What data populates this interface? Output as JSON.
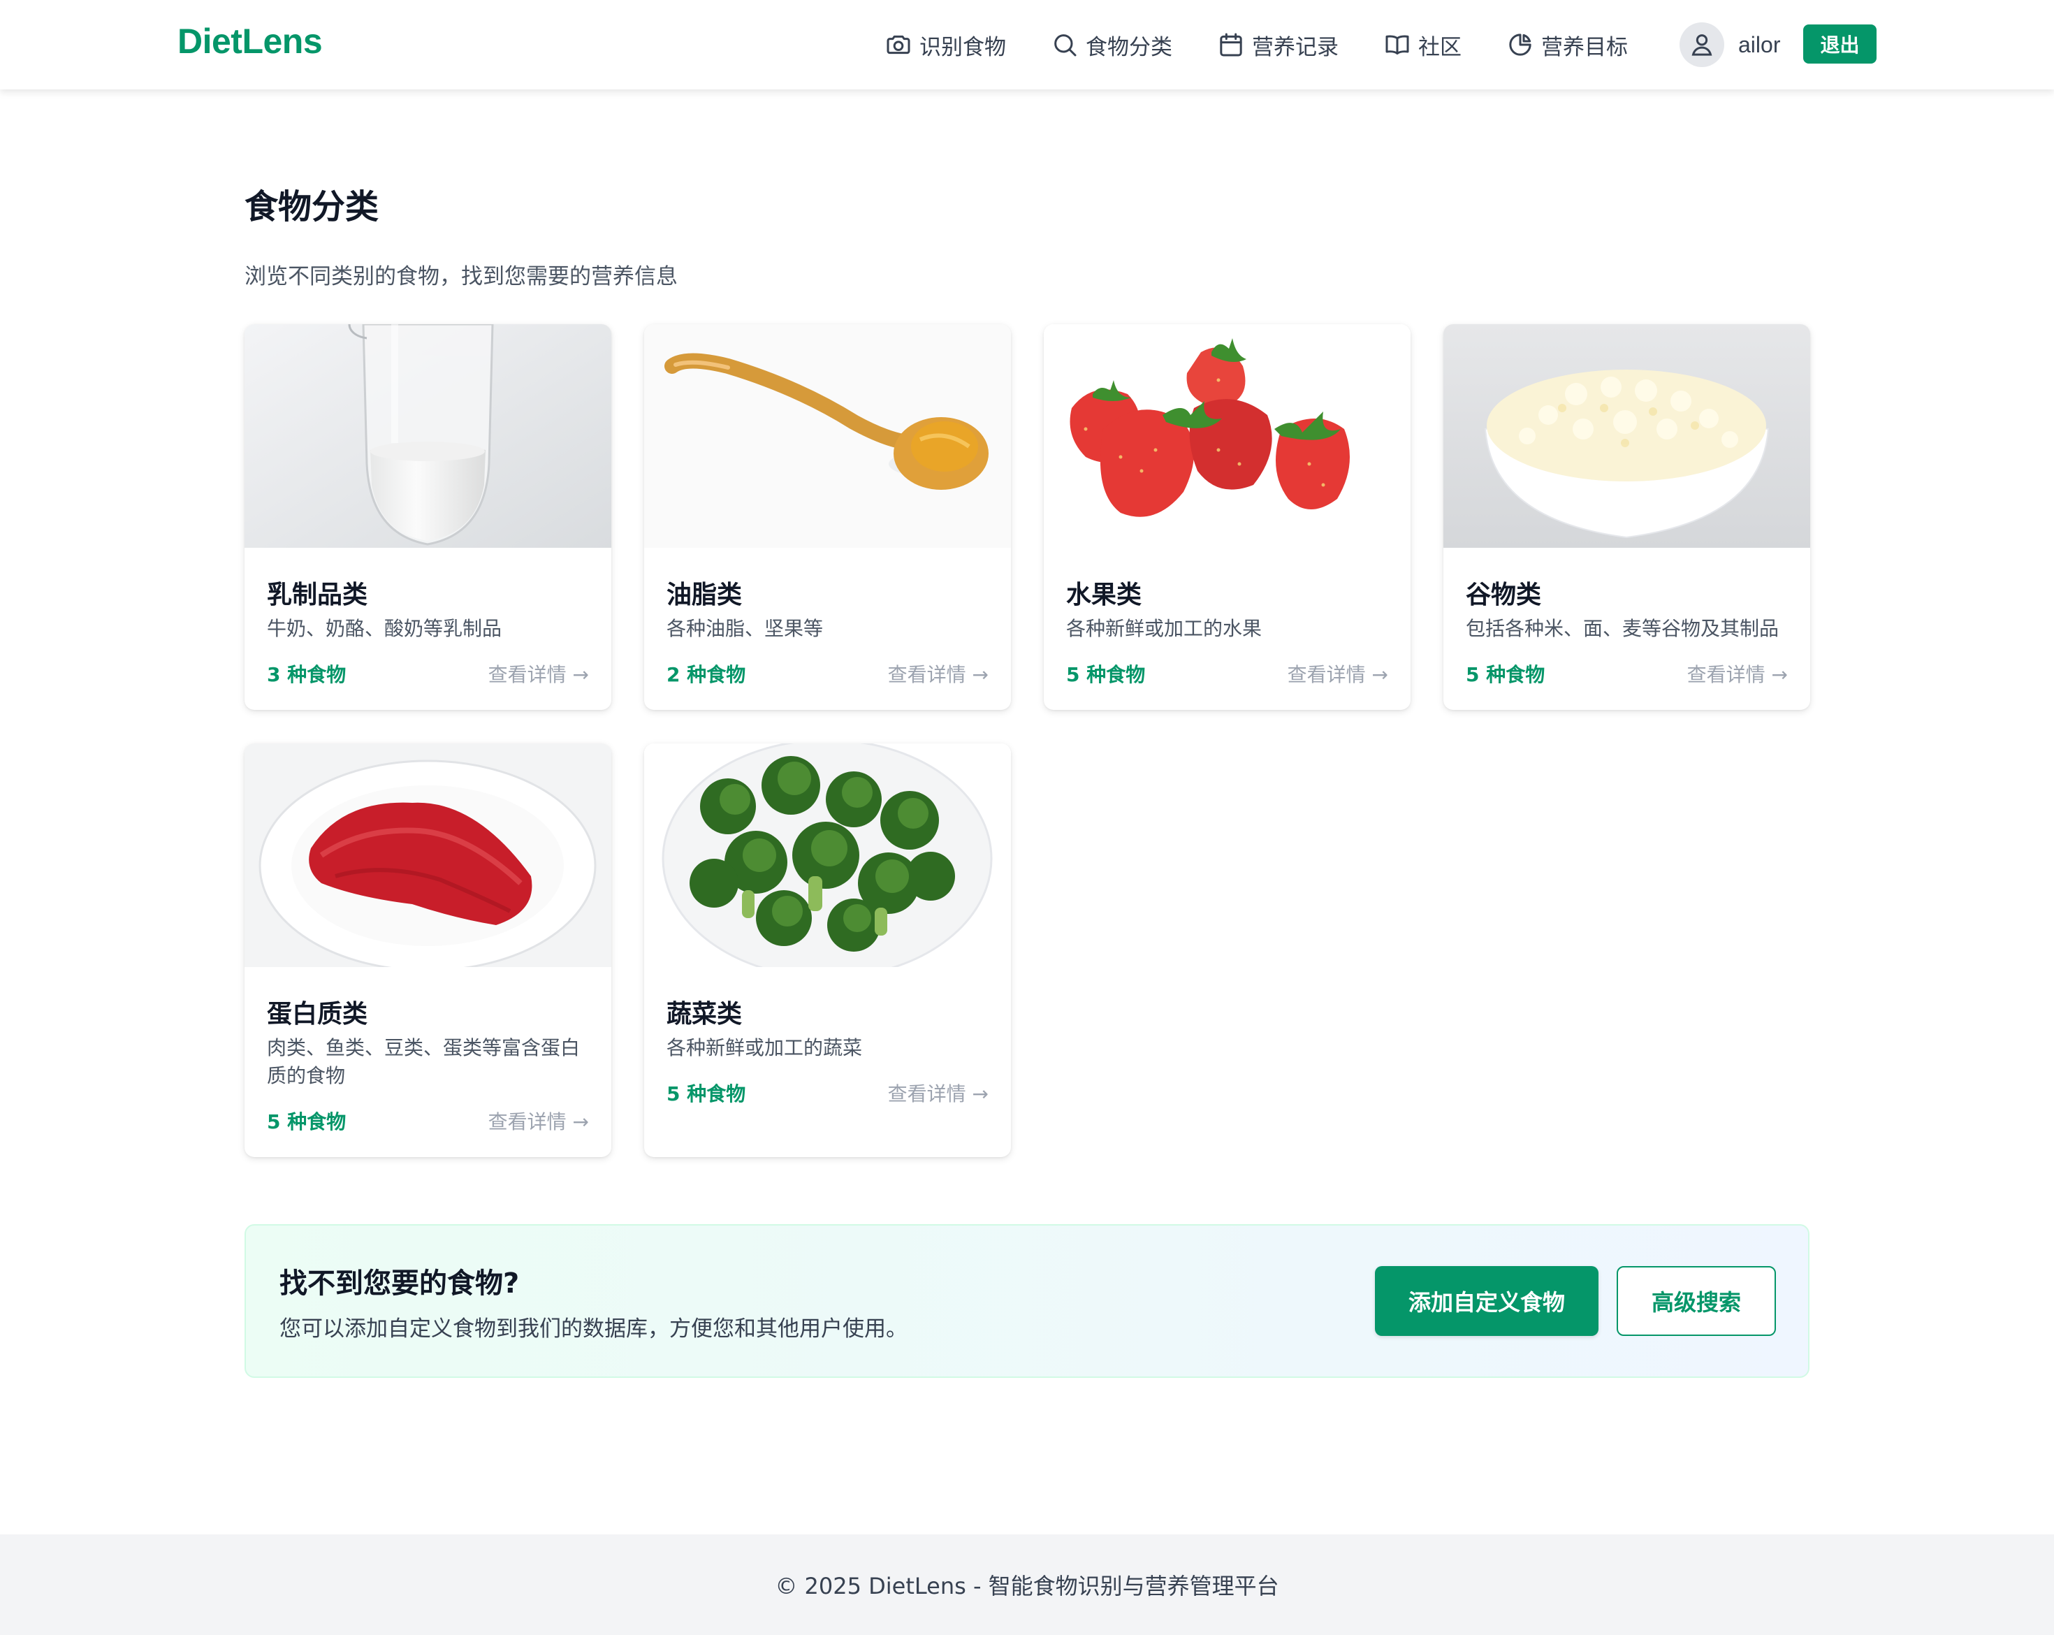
{
  "header": {
    "logo": "DietLens",
    "nav": [
      {
        "label": "识别食物",
        "icon": "camera-icon"
      },
      {
        "label": "食物分类",
        "icon": "search-icon"
      },
      {
        "label": "营养记录",
        "icon": "calendar-icon"
      },
      {
        "label": "社区",
        "icon": "book-icon"
      },
      {
        "label": "营养目标",
        "icon": "pie-chart-icon"
      }
    ],
    "username": "ailor",
    "logout_label": "退出"
  },
  "main": {
    "title": "食物分类",
    "subtitle": "浏览不同类别的食物，找到您需要的营养信息",
    "categories": [
      {
        "name": "乳制品类",
        "desc": "牛奶、奶酪、酸奶等乳制品",
        "count": "3 种食物",
        "link": "查看详情 →",
        "image": "milk-glass"
      },
      {
        "name": "油脂类",
        "desc": "各种油脂、坚果等",
        "count": "2 种食物",
        "link": "查看详情 →",
        "image": "wooden-spoon"
      },
      {
        "name": "水果类",
        "desc": "各种新鲜或加工的水果",
        "count": "5 种食物",
        "link": "查看详情 →",
        "image": "strawberries"
      },
      {
        "name": "谷物类",
        "desc": "包括各种米、面、麦等谷物及其制品",
        "count": "5 种食物",
        "link": "查看详情 →",
        "image": "rice-bowl"
      },
      {
        "name": "蛋白质类",
        "desc": "肉类、鱼类、豆类、蛋类等富含蛋白质的食物",
        "count": "5 种食物",
        "link": "查看详情 →",
        "image": "raw-beef"
      },
      {
        "name": "蔬菜类",
        "desc": "各种新鲜或加工的蔬菜",
        "count": "5 种食物",
        "link": "查看详情 →",
        "image": "broccoli"
      }
    ]
  },
  "cta": {
    "title": "找不到您要的食物?",
    "desc": "您可以添加自定义食物到我们的数据库，方便您和其他用户使用。",
    "primary_label": "添加自定义食物",
    "secondary_label": "高级搜索"
  },
  "footer": {
    "text": "© 2025 DietLens - 智能食物识别与营养管理平台"
  },
  "colors": {
    "brand": "#059669",
    "text": "#111827",
    "muted": "#4b5563",
    "link_muted": "#9ca3af",
    "footer_bg": "#f3f4f6"
  }
}
